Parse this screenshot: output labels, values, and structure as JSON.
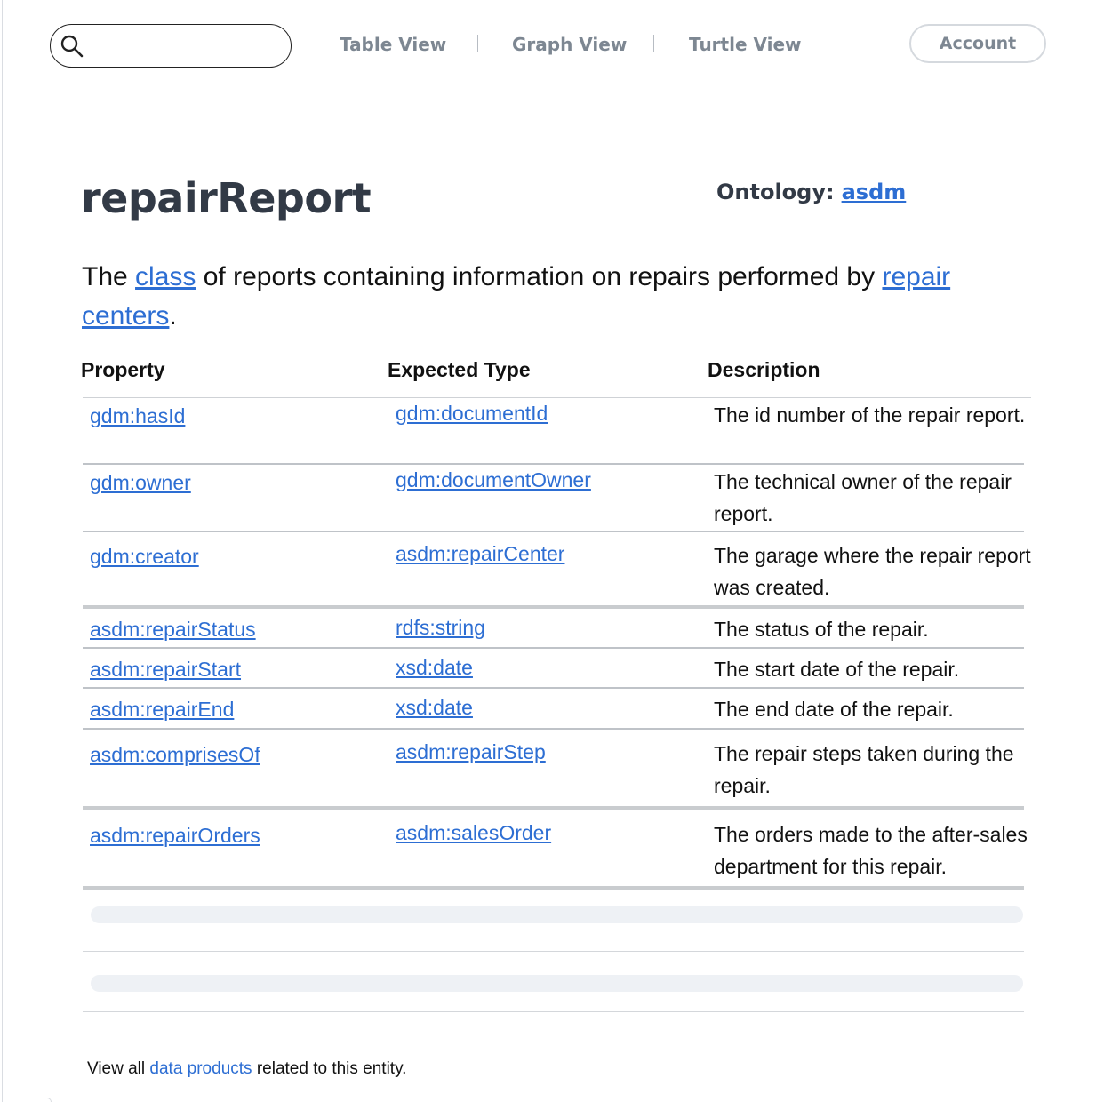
{
  "search": {
    "placeholder": "",
    "icon": "search-icon"
  },
  "nav": {
    "tabs": [
      "Table View",
      "Graph View",
      "Turtle View"
    ],
    "account_label": "Account"
  },
  "entity": {
    "title": "repairReport",
    "ontology_label": "Ontology:",
    "ontology_value": "asdm",
    "intro": {
      "t1": "The ",
      "link1": "class",
      "t2": " of reports containing information on repairs performed by ",
      "link2": "repair centers",
      "t3": "."
    }
  },
  "table": {
    "headers": [
      "Property",
      "Expected Type",
      "Description"
    ],
    "rows": [
      {
        "property": "gdm:hasId",
        "type": "gdm:documentId",
        "description": "The id number of the repair report."
      },
      {
        "property": "gdm:owner",
        "type": "gdm:documentOwner",
        "description": "The technical owner of the repair report."
      },
      {
        "property": "gdm:creator",
        "type": "asdm:repairCenter",
        "description": "The garage where the repair report was created."
      },
      {
        "property": "asdm:repairStatus",
        "type": "rdfs:string",
        "description": "The status of the repair."
      },
      {
        "property": "asdm:repairStart",
        "type": "xsd:date",
        "description": "The start date of the repair."
      },
      {
        "property": "asdm:repairEnd",
        "type": "xsd:date",
        "description": "The end date of the repair."
      },
      {
        "property": "asdm:comprisesOf",
        "type": "asdm:repairStep",
        "description": "The repair steps taken during the repair."
      },
      {
        "property": "asdm:repairOrders",
        "type": "asdm:salesOrder",
        "description": "The orders made to the after-sales department for this repair."
      }
    ]
  },
  "footer": {
    "t1": "View all ",
    "link": "data products",
    "t2": " related to this entity."
  },
  "colors": {
    "link": "#2d6ed3",
    "title": "#323a46",
    "nav": "#7d8792"
  }
}
